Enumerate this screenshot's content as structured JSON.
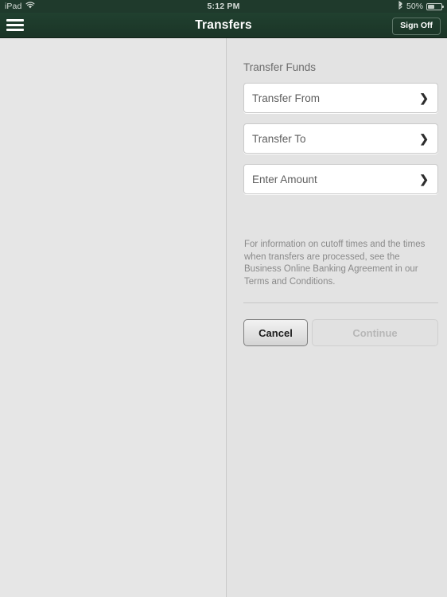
{
  "statusbar": {
    "device": "iPad",
    "wifi_icon": "wifi-icon",
    "time": "5:12 PM",
    "bluetooth_icon": "bluetooth-icon",
    "battery_percent": "50%",
    "battery_icon": "battery-icon"
  },
  "navbar": {
    "menu_icon": "hamburger-menu-icon",
    "title": "Transfers",
    "signoff_label": "Sign Off"
  },
  "form": {
    "section_title": "Transfer Funds",
    "fields": [
      {
        "label": "Transfer From",
        "chevron": "❯",
        "icon": "chevron-right-icon"
      },
      {
        "label": "Transfer To",
        "chevron": "❯",
        "icon": "chevron-right-icon"
      },
      {
        "label": "Enter Amount",
        "chevron": "❯",
        "icon": "chevron-right-icon"
      }
    ],
    "helper_text": "For information on cutoff times and the times when transfers are processed, see the Business Online Banking Agreement in our Terms and Conditions."
  },
  "actions": {
    "cancel_label": "Cancel",
    "continue_label": "Continue"
  },
  "colors": {
    "header_green": "#1f3a2c",
    "page_background": "#e3e3e3",
    "field_white": "#ffffff",
    "helper_gray": "#8a8a8a"
  }
}
